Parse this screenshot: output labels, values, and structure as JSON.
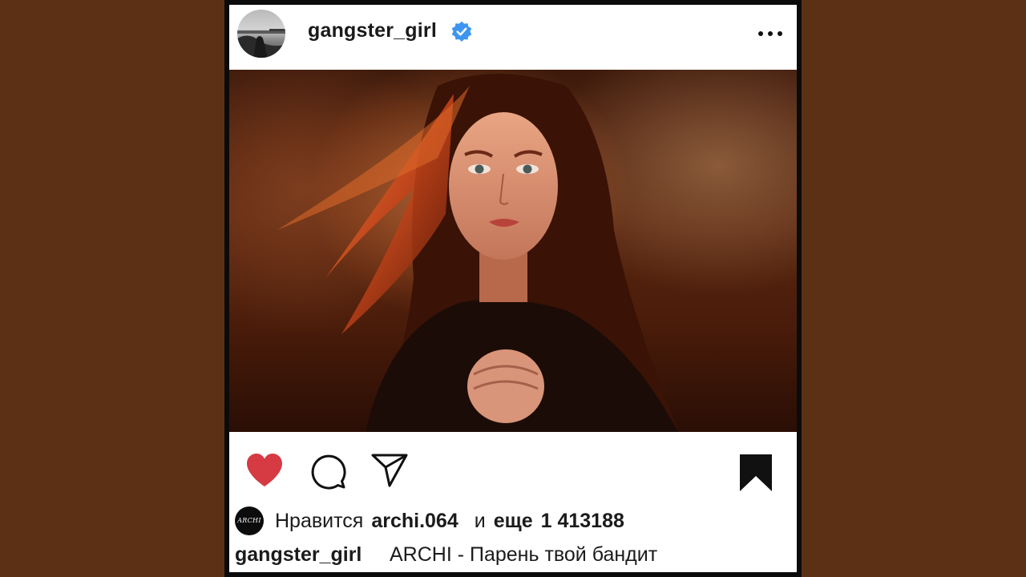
{
  "post": {
    "username": "gangster_girl",
    "verified": true,
    "avatar_icon": "profile-photo",
    "photo_icon": "portrait-photo"
  },
  "actions": {
    "like_icon": "heart-icon",
    "liked": true,
    "like_color": "#d63a43",
    "comment_icon": "comment-icon",
    "share_icon": "send-icon",
    "save_icon": "bookmark-icon"
  },
  "likes": {
    "liker_avatar_text": "ARCHI",
    "prefix": "Нравится",
    "liker": "archi.064",
    "conjunction": "и",
    "more_label": "еще",
    "count": "1 413188"
  },
  "caption": {
    "username": "gangster_girl",
    "text": "ARCHI - Парень твой бандит"
  },
  "colors": {
    "background": "#5b3015",
    "verified_badge": "#3d95ef"
  }
}
